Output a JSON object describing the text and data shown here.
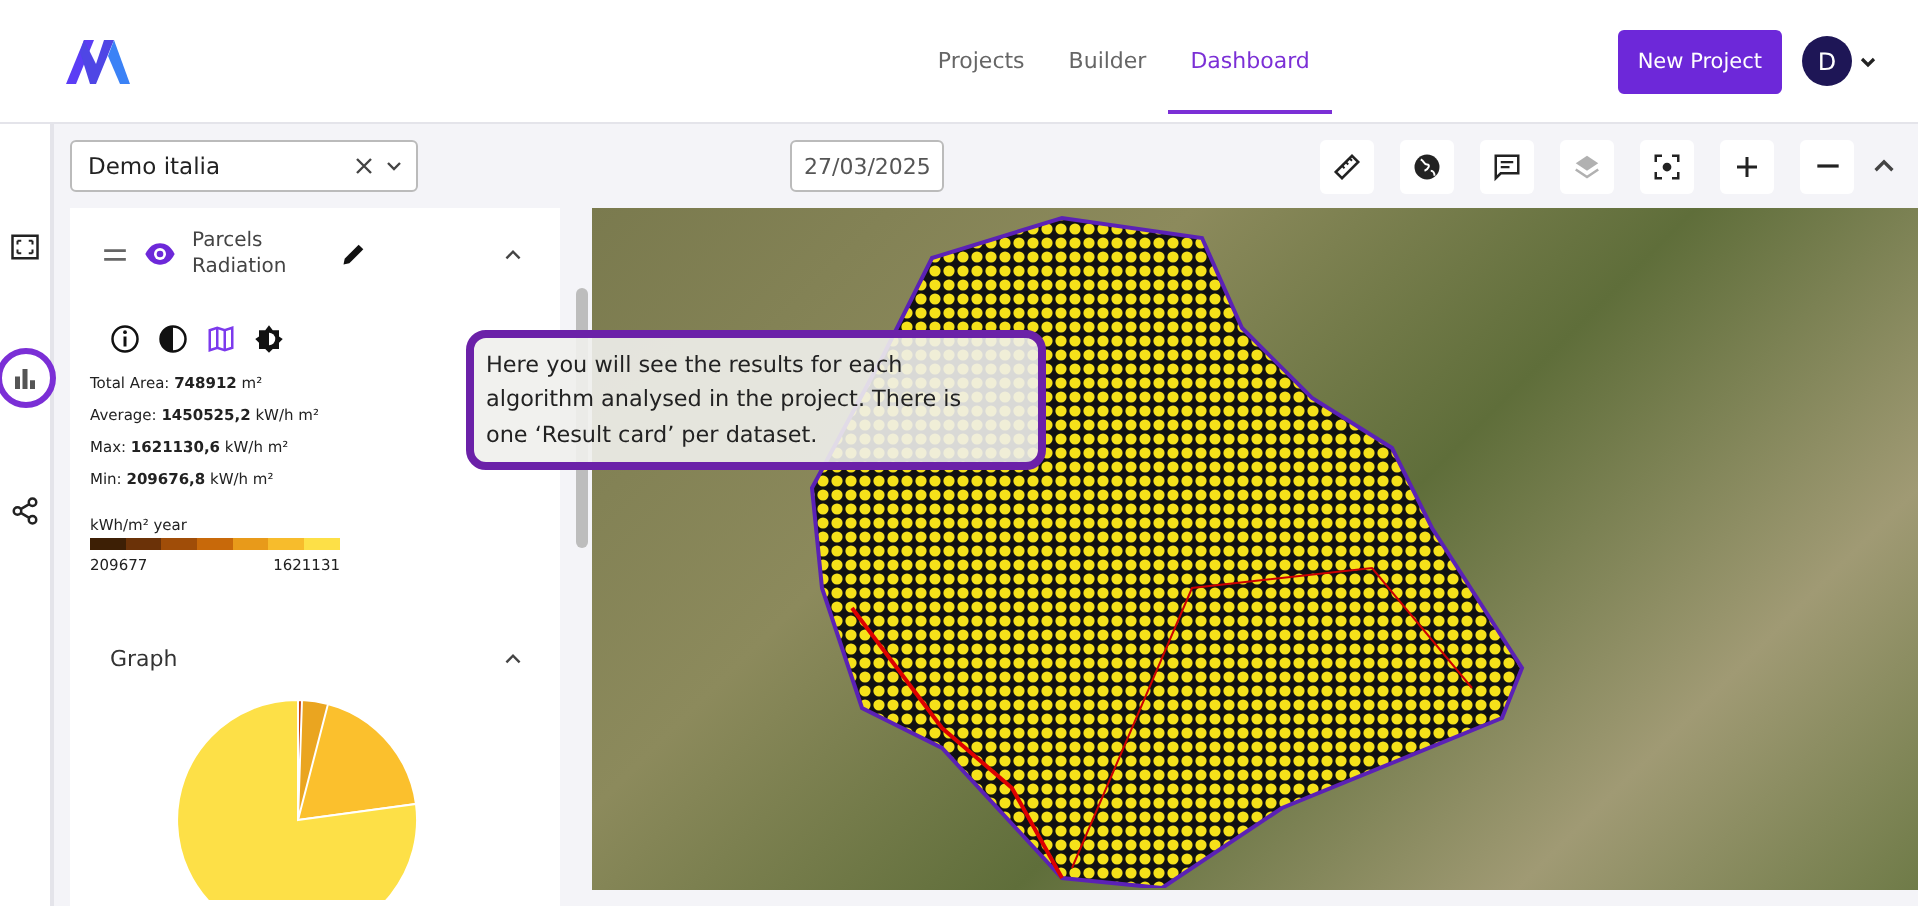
{
  "header": {
    "tabs": [
      {
        "label": "Projects",
        "selected": false
      },
      {
        "label": "Builder",
        "selected": false
      },
      {
        "label": "Dashboard",
        "selected": true
      }
    ],
    "new_button": "New Project",
    "avatar": "D"
  },
  "rail": [
    {
      "kind": "frame",
      "highlighted": false
    },
    {
      "kind": "chart",
      "highlighted": true
    },
    {
      "kind": "share",
      "highlighted": false
    }
  ],
  "toolbar": {
    "project": "Demo italia",
    "date": "27/03/2025",
    "tools": [
      {
        "kind": "ruler",
        "disabled": false
      },
      {
        "kind": "globe",
        "disabled": false
      },
      {
        "kind": "comment",
        "disabled": false
      },
      {
        "kind": "layers",
        "disabled": true
      },
      {
        "kind": "focus",
        "disabled": false
      },
      {
        "kind": "plus",
        "disabled": false
      },
      {
        "kind": "minus",
        "disabled": false
      }
    ]
  },
  "result_card": {
    "title": "Parcels Radiation",
    "views": [
      {
        "kind": "info",
        "selected": false
      },
      {
        "kind": "contrast",
        "selected": false
      },
      {
        "kind": "map",
        "selected": true
      },
      {
        "kind": "brightness",
        "selected": false
      }
    ],
    "stats": [
      "Total Area: **748912** m²",
      "Average: **1450525,2** kW/h m²",
      "Max: **1621130,6** kW/h m²",
      "Min: **209676,8** kW/h m²"
    ],
    "legend": {
      "unit": "kWh/m² year",
      "min": "209677",
      "max": "1621131"
    }
  },
  "graph": {
    "title": "Graph"
  },
  "tooltip": "Here you will see the results for each algorithm analysed in the project. There is one ‘Result card’ per dataset."
}
